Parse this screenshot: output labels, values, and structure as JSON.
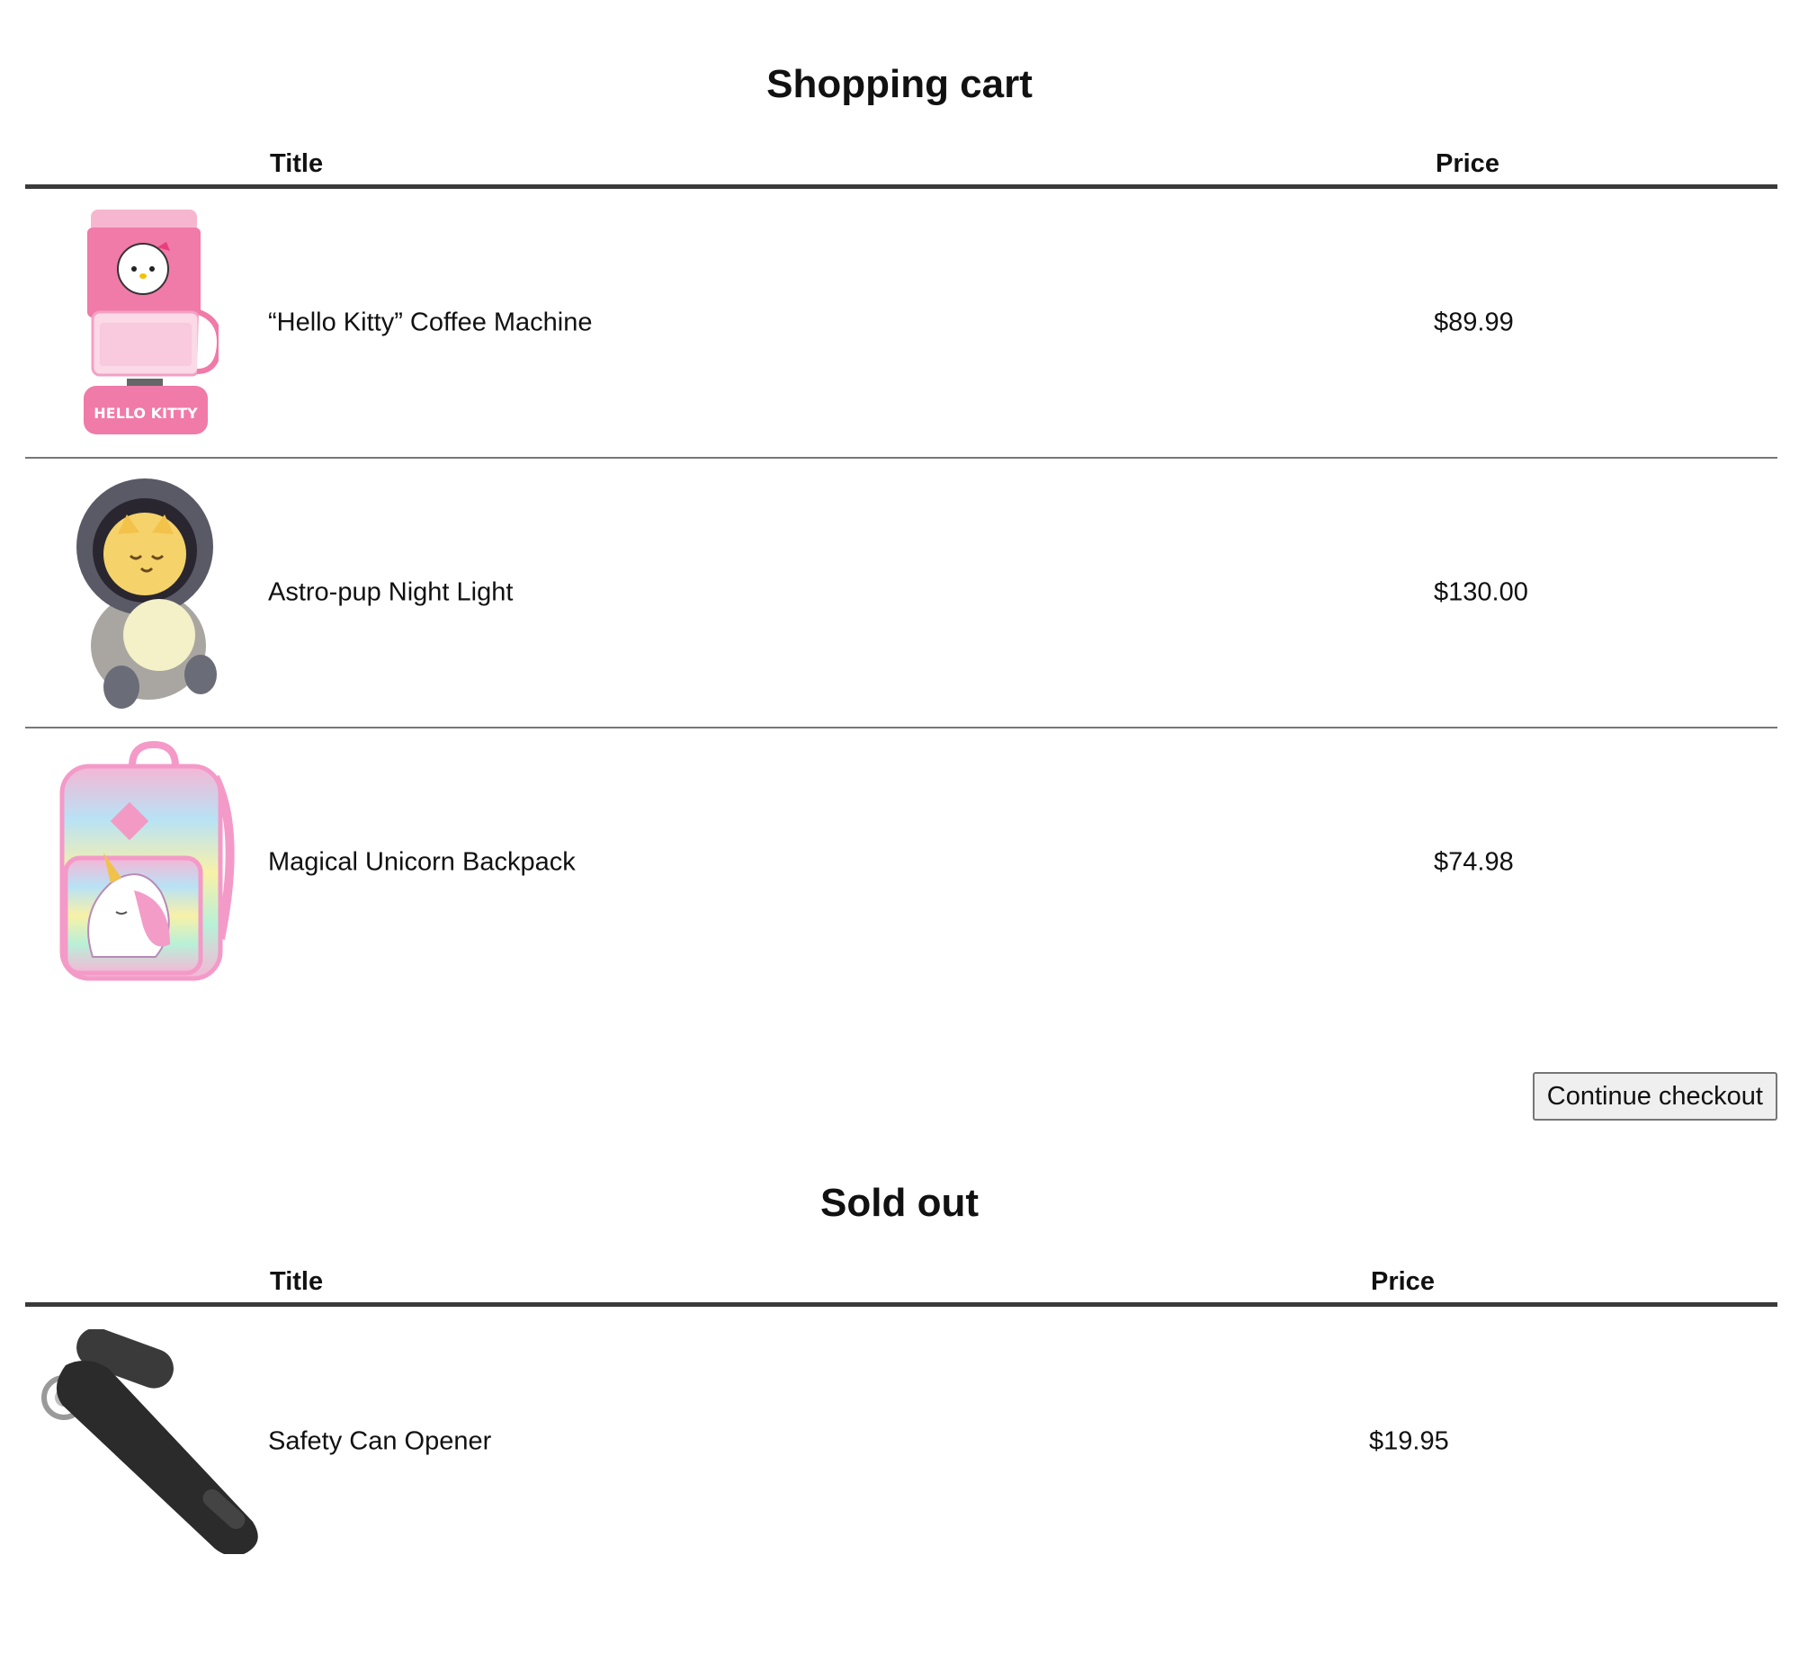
{
  "cart": {
    "title": "Shopping cart",
    "columns": {
      "title": "Title",
      "price": "Price"
    },
    "items": [
      {
        "title": "“Hello Kitty” Coffee Machine",
        "price": "$89.99",
        "image_icon": "hello-kitty-coffee-machine-icon"
      },
      {
        "title": "Astro-pup Night Light",
        "price": "$130.00",
        "image_icon": "astro-pup-night-light-icon"
      },
      {
        "title": "Magical Unicorn Backpack",
        "price": "$74.98",
        "image_icon": "unicorn-backpack-icon"
      }
    ],
    "checkout_label": "Continue checkout"
  },
  "sold_out": {
    "title": "Sold out",
    "columns": {
      "title": "Title",
      "price": "Price"
    },
    "items": [
      {
        "title": "Safety Can Opener",
        "price": "$19.95",
        "image_icon": "can-opener-icon"
      }
    ]
  },
  "colors": {
    "coffee_machine_pink": "#f07aa8",
    "night_light_glow": "#f5d36a",
    "backpack_pink": "#f49ac8",
    "can_opener_dark": "#2b2b2b"
  }
}
